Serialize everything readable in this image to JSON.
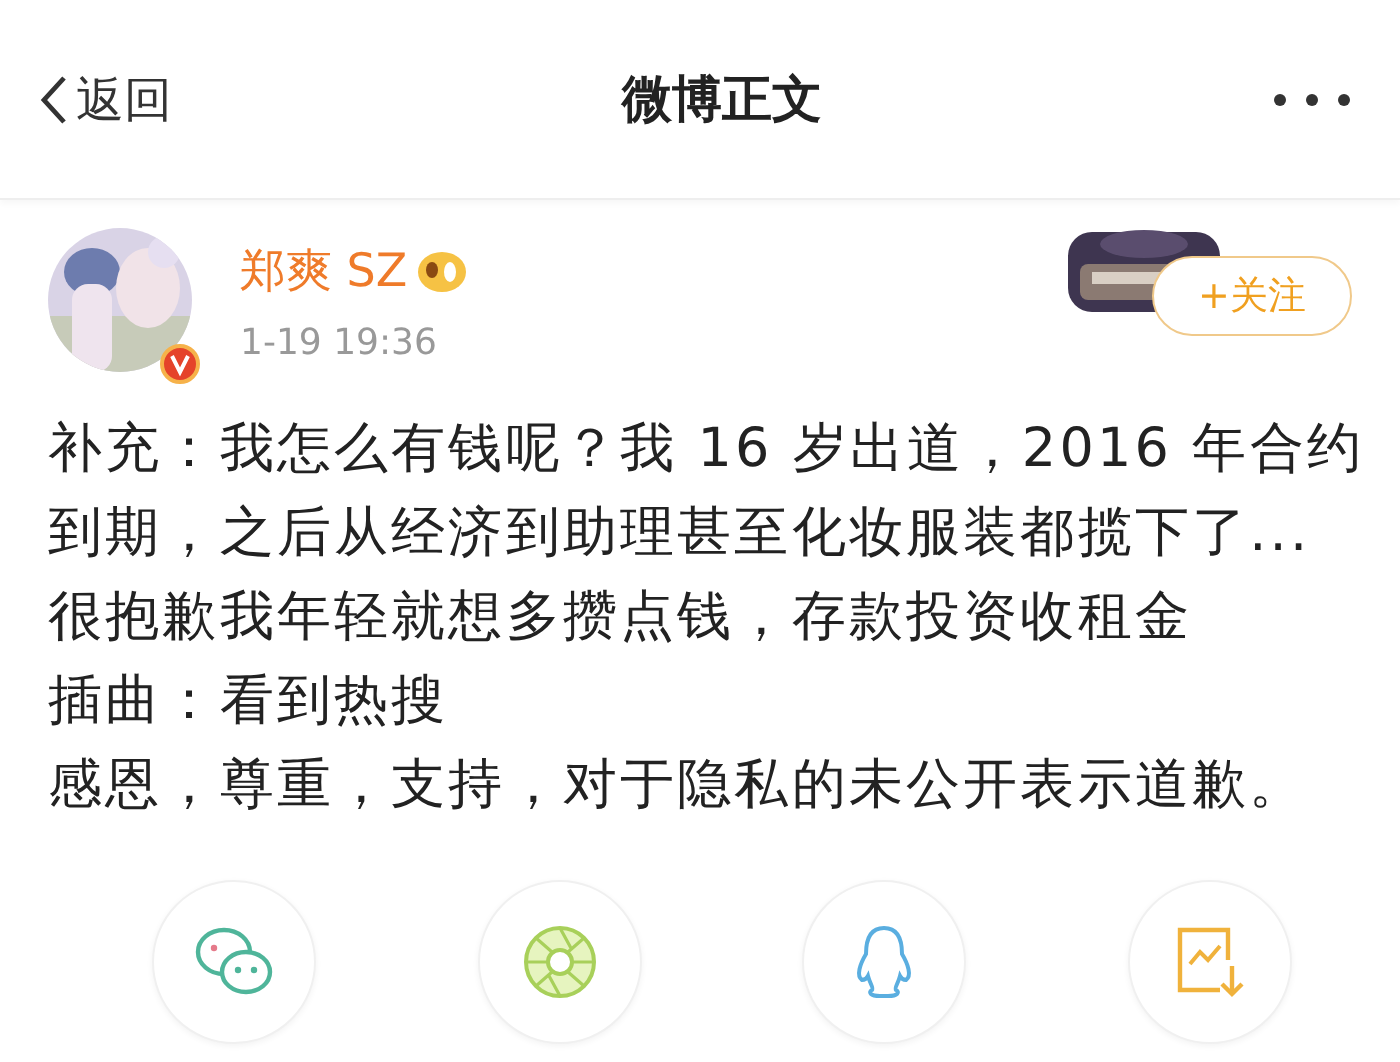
{
  "header": {
    "back_label": "返回",
    "title": "微博正文"
  },
  "post": {
    "author": "郑爽 SZ",
    "verified": true,
    "time": "1-19 19:36",
    "follow_label": "+关注",
    "lines": [
      "补充：我怎么有钱呢？我 16 岁出道，2016 年合约",
      "到期，之后从经济到助理甚至化妆服装都揽下了...",
      "很抱歉我年轻就想多攒点钱，存款投资收租金",
      "插曲：看到热搜",
      "感恩，尊重，支持，对于隐私的未公开表示道歉。"
    ]
  },
  "share": [
    {
      "kind": "wechat"
    },
    {
      "kind": "moments"
    },
    {
      "kind": "qq"
    },
    {
      "kind": "save"
    }
  ]
}
